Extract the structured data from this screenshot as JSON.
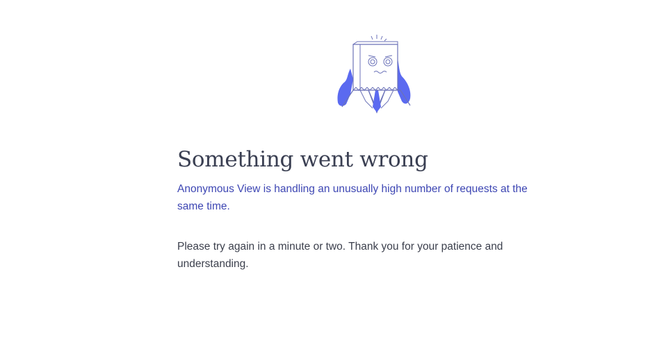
{
  "error": {
    "title": "Something went wrong",
    "subtitle": "Anonymous View is handling an unusually high number of requests at the same time.",
    "message": "Please try again in a minute or two. Thank you for your patience and understanding.",
    "illustration_icon": "stressed-person-paper-bag-icon"
  },
  "colors": {
    "title": "#3a3f52",
    "subtitle": "#3d46b3",
    "body": "#3b3f4c",
    "accent": "#5b6af0",
    "line": "#6b72b8"
  }
}
